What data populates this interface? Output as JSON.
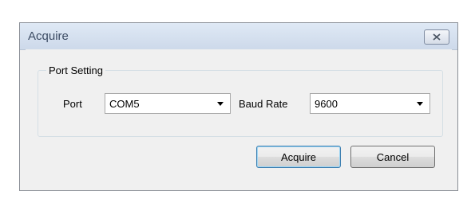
{
  "window": {
    "title": "Acquire",
    "close_icon": "close-icon"
  },
  "port_setting": {
    "group_label": "Port Setting",
    "port_label": "Port",
    "port_value": "COM5",
    "baud_label": "Baud Rate",
    "baud_value": "9600"
  },
  "buttons": {
    "acquire_label": "Acquire",
    "cancel_label": "Cancel"
  }
}
